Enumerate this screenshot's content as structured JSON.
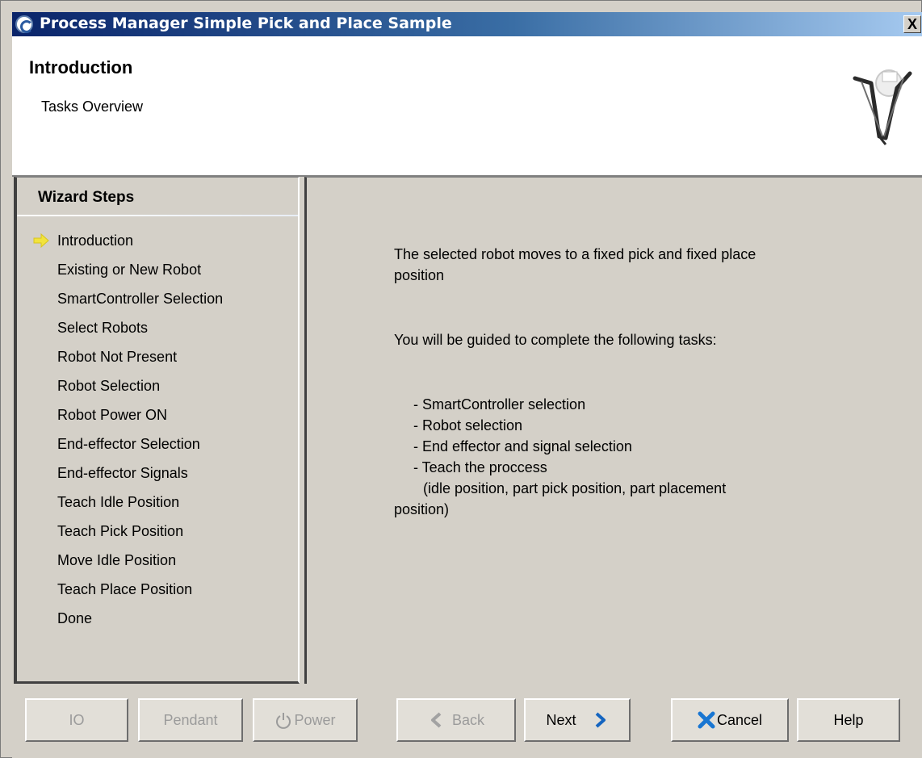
{
  "window": {
    "title": "Process Manager Simple Pick and Place Sample",
    "close_label": "X"
  },
  "header": {
    "title": "Introduction",
    "subtitle": "Tasks Overview"
  },
  "wizard": {
    "heading": "Wizard Steps",
    "current_step": "Introduction",
    "steps": [
      "Introduction",
      "Existing or New Robot",
      "SmartController Selection",
      "Select Robots",
      "Robot Not Present",
      "Robot Selection",
      "Robot Power ON",
      "End-effector Selection",
      "End-effector Signals",
      "Teach Idle Position",
      "Teach Pick Position",
      "Move Idle Position",
      "Teach Place Position",
      "Done"
    ]
  },
  "content": {
    "intro_line1": "The selected robot moves to a fixed pick and fixed place",
    "intro_line2": "position",
    "guided": "You will be guided to complete the following tasks:",
    "tasks": [
      "- SmartController selection",
      "- Robot selection",
      "- End effector and signal selection",
      "- Teach the proccess"
    ],
    "task_detail_line1": "(idle position, part pick position, part placement",
    "task_detail_line2": "position)"
  },
  "footer": {
    "io_label": "IO",
    "pendant_label": "Pendant",
    "power_label": "Power",
    "back_label": "Back",
    "next_label": "Next",
    "cancel_label": "Cancel",
    "help_label": "Help"
  },
  "colors": {
    "title_bar_start": "#0a246a",
    "title_bar_end": "#a6caf0",
    "window_face": "#d4d0c8",
    "current_step_arrow": "#f2e33c",
    "next_chevron": "#1565c0",
    "cancel_x": "#1976d2"
  },
  "icons": {
    "app": "app-logo-icon",
    "current_step": "arrow-right-icon",
    "power": "power-icon",
    "back": "chevron-left-icon",
    "next": "chevron-right-icon",
    "cancel": "x-icon",
    "header_graphic": "delta-robot-icon"
  }
}
